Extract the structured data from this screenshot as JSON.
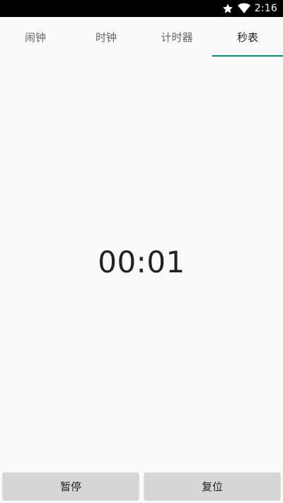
{
  "status_bar": {
    "time": "2:16",
    "icons": [
      "star-icon",
      "wifi-icon"
    ]
  },
  "tabs": [
    {
      "label": "闹钟",
      "active": false
    },
    {
      "label": "时钟",
      "active": false
    },
    {
      "label": "计时器",
      "active": false
    },
    {
      "label": "秒表",
      "active": true
    }
  ],
  "stopwatch": {
    "elapsed": "00:01"
  },
  "buttons": {
    "pause_label": "暂停",
    "reset_label": "复位"
  },
  "colors": {
    "accent": "#00897b",
    "background": "#fafafa",
    "button": "#d6d6d6"
  }
}
